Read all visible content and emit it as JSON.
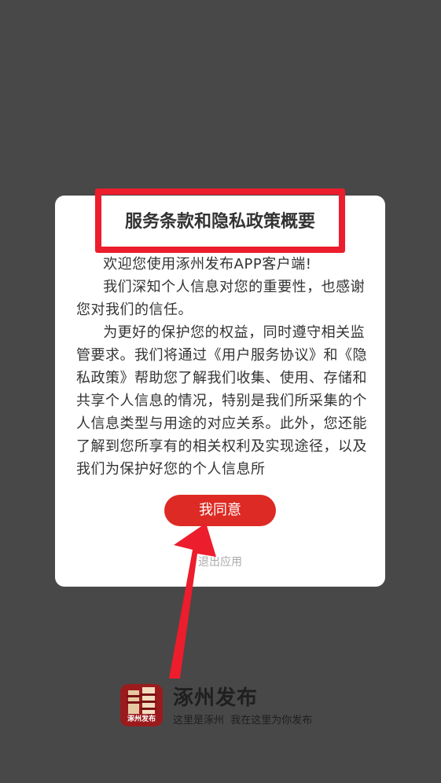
{
  "dialog": {
    "title": "服务条款和隐私政策概要",
    "paragraphs": [
      "欢迎您使用涿州发布APP客户端!",
      "我们深知个人信息对您的重要性，也感谢您对我们的信任。",
      "为更好的保护您的权益，同时遵守相关监管要求。我们将通过《用户服务协议》和《隐私政策》帮助您了解我们收集、使用、存储和共享个人信息的情况，特别是我们所采集的个人信息类型与用途的对应关系。此外，您还能了解到您所享有的相关权利及实现途径，以及我们为保护好您的个人信息所"
    ],
    "agree_label": "我同意",
    "exit_label": "退出应用"
  },
  "brand": {
    "name": "涿州发布",
    "slogan": "这里是涿州  我在这里为你发布",
    "logo_text": "涿州发布"
  },
  "colors": {
    "overlay": "#484848",
    "accent_red": "#dd2a24",
    "highlight_red": "#ec1d2c"
  }
}
